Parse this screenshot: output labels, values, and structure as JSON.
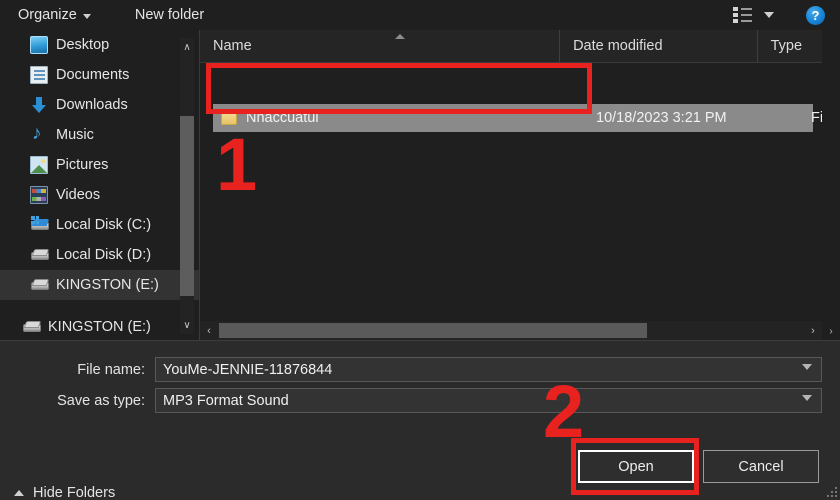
{
  "toolbar": {
    "organize_label": "Organize",
    "new_folder_label": "New folder",
    "view_icon": "list-view-icon",
    "view_caret_icon": "chevron-down-icon",
    "help_label": "?"
  },
  "sidebar": {
    "scroll_up_icon": "∧",
    "scroll_down_icon": "∨",
    "items": [
      {
        "label": "Desktop",
        "icon": "desktop-icon",
        "level": "lvl2",
        "selected": false
      },
      {
        "label": "Documents",
        "icon": "documents-icon",
        "level": "lvl2",
        "selected": false
      },
      {
        "label": "Downloads",
        "icon": "downloads-icon",
        "level": "lvl2",
        "selected": false
      },
      {
        "label": "Music",
        "icon": "music-icon",
        "level": "lvl2",
        "selected": false
      },
      {
        "label": "Pictures",
        "icon": "pictures-icon",
        "level": "lvl2",
        "selected": false
      },
      {
        "label": "Videos",
        "icon": "videos-icon",
        "level": "lvl2",
        "selected": false
      },
      {
        "label": "Local Disk (C:)",
        "icon": "windows-drive-icon",
        "level": "lvl2",
        "selected": false
      },
      {
        "label": "Local Disk (D:)",
        "icon": "drive-icon",
        "level": "lvl2",
        "selected": false
      },
      {
        "label": "KINGSTON (E:)",
        "icon": "drive-icon",
        "level": "lvl2",
        "selected": true
      },
      {
        "label": "KINGSTON (E:)",
        "icon": "drive-icon",
        "level": "root",
        "selected": false
      }
    ]
  },
  "file_list": {
    "columns": [
      {
        "key": "name",
        "label": "Name"
      },
      {
        "key": "date",
        "label": "Date modified"
      },
      {
        "key": "type",
        "label": "Type"
      }
    ],
    "sort_column": "Name",
    "sort_direction": "ascending",
    "rows": [
      {
        "name": "Nhaccuatui",
        "date": "10/18/2023 3:21 PM",
        "type": "File fo",
        "icon": "folder-icon",
        "selected": true
      }
    ],
    "hscroll_left_icon": "‹",
    "hscroll_right_icon": "›",
    "vscroll_right_icon": "›"
  },
  "form": {
    "file_name_label": "File name:",
    "file_name_value": "YouMe-JENNIE-11876844",
    "save_as_type_label": "Save as type:",
    "save_as_type_value": "MP3 Format Sound",
    "dropdown_icon": "chevron-down-icon"
  },
  "footer": {
    "hide_folders_label": "Hide Folders",
    "hide_folders_icon": "chevron-up-icon",
    "open_label": "Open",
    "cancel_label": "Cancel"
  },
  "annotations": {
    "step_one": "1",
    "step_two": "2",
    "highlight_color": "#e8221f"
  }
}
